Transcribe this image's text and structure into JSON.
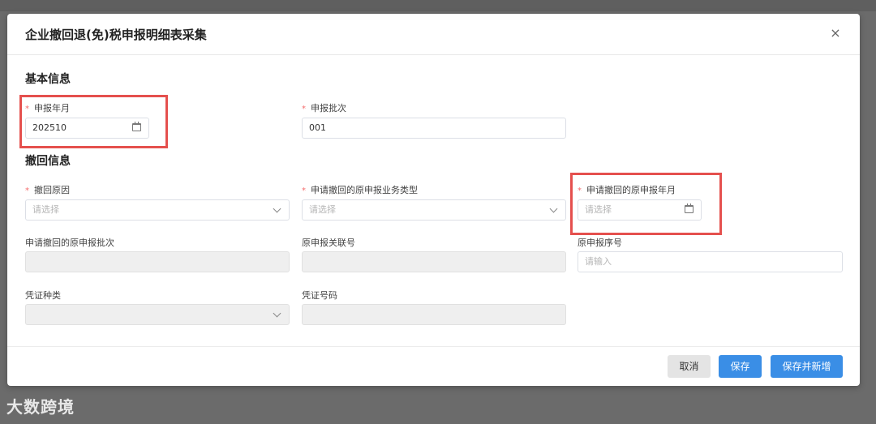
{
  "dialog": {
    "title": "企业撤回退(免)税申报明细表采集",
    "close_symbol": "×"
  },
  "basic_section": {
    "title": "基本信息",
    "report_month": {
      "label": "申报年月",
      "value": "202510",
      "required": true
    },
    "report_batch": {
      "label": "申报批次",
      "value": "001",
      "required": true
    }
  },
  "withdraw_section": {
    "title": "撤回信息",
    "withdraw_reason": {
      "label": "撤回原因",
      "placeholder": "请选择",
      "required": true
    },
    "original_business_type": {
      "label": "申请撤回的原申报业务类型",
      "placeholder": "请选择",
      "required": true
    },
    "original_report_month": {
      "label": "申请撤回的原申报年月",
      "placeholder": "请选择",
      "required": true
    },
    "original_report_batch": {
      "label": "申请撤回的原申报批次"
    },
    "original_link_no": {
      "label": "原申报关联号"
    },
    "original_serial_no": {
      "label": "原申报序号",
      "placeholder": "请输入"
    },
    "voucher_type": {
      "label": "凭证种类"
    },
    "voucher_number": {
      "label": "凭证号码"
    }
  },
  "footer": {
    "cancel_label": "取消",
    "save_label": "保存",
    "save_new_label": "保存并新增"
  },
  "required_mark": "*",
  "watermark_text": "大数跨境",
  "colors": {
    "primary": "#3a8ee6",
    "highlight": "#e5504e",
    "required": "#f56c6c"
  }
}
